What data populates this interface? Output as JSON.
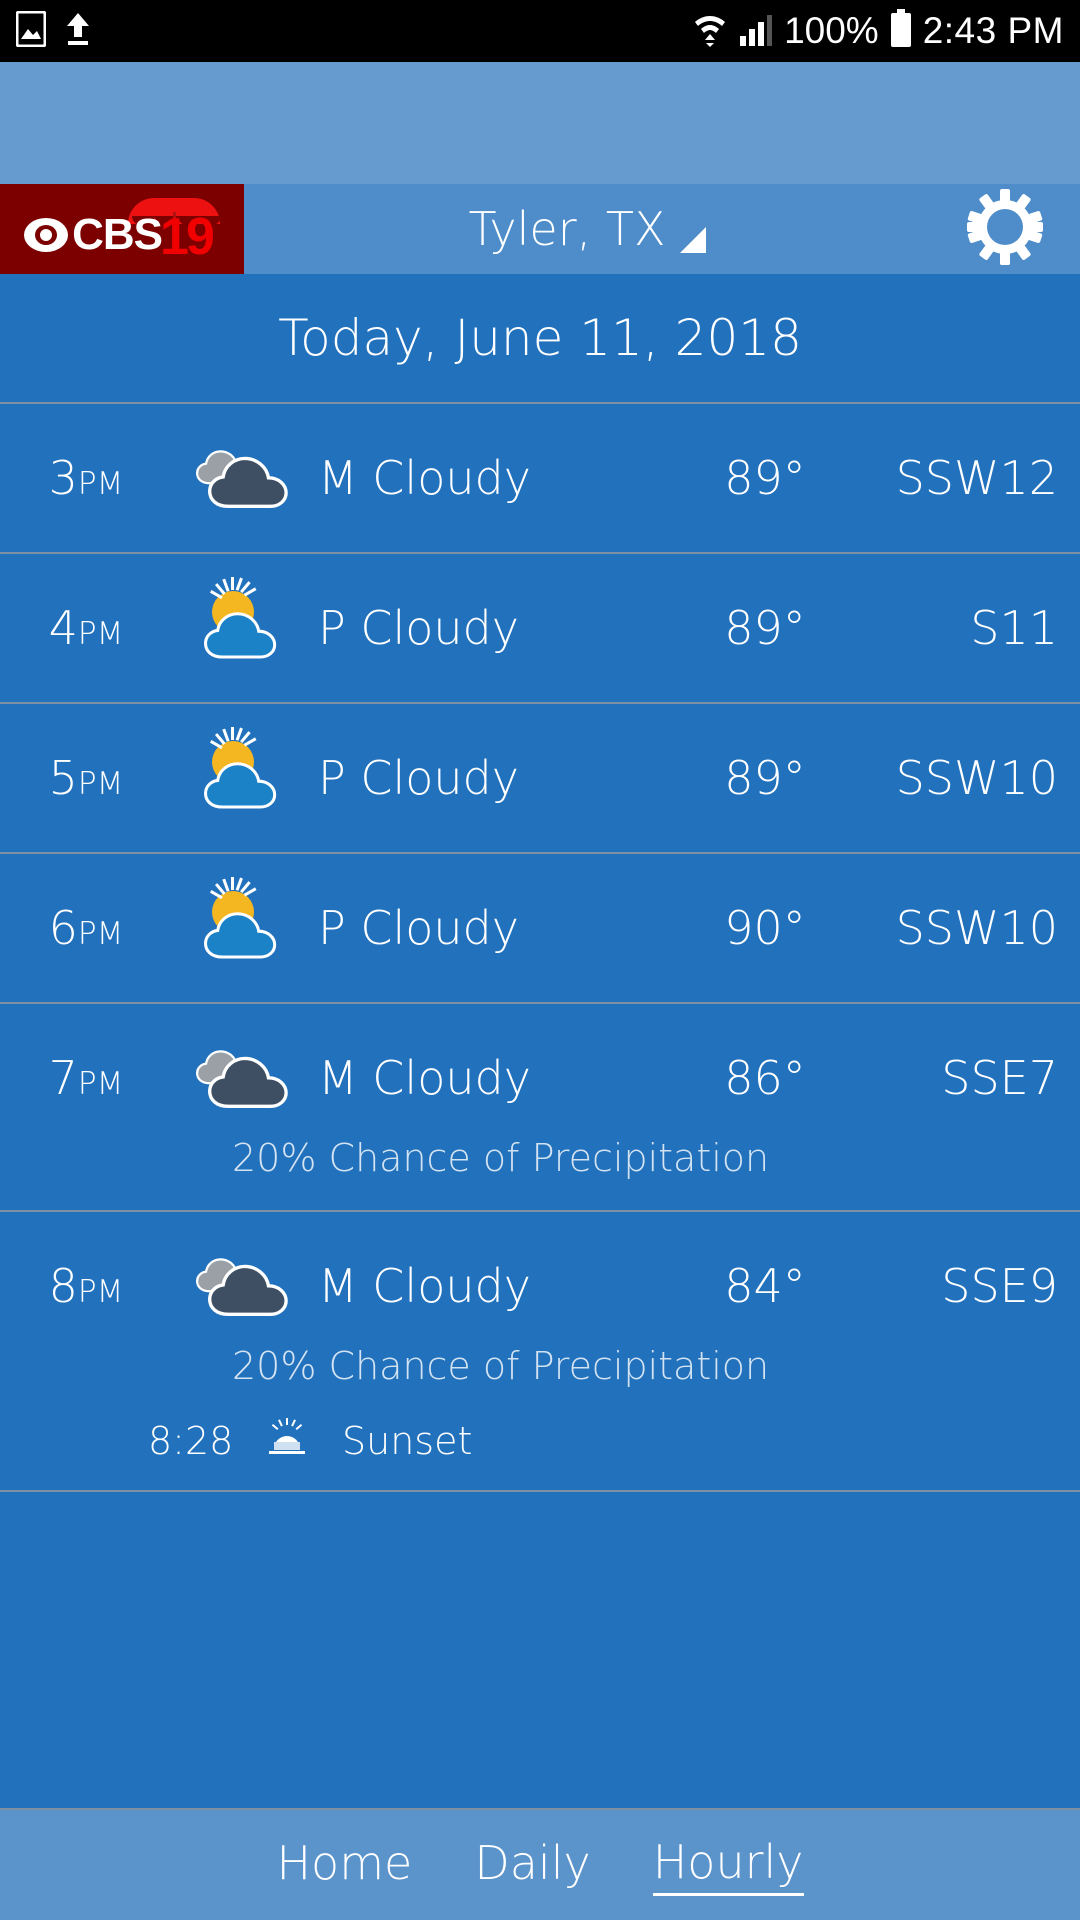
{
  "status_bar": {
    "icons": [
      "image-icon",
      "upload-icon",
      "wifi-icon",
      "signal-icon"
    ],
    "battery_percent": "100%",
    "time": "2:43 PM"
  },
  "header": {
    "logo": {
      "eye": "cbs-eye-icon",
      "network": "CBS",
      "channel": "19",
      "umbrella": "umbrella-icon"
    },
    "location": "Tyler, TX",
    "location_caret": "dropdown-caret-icon",
    "settings_icon": "gear-icon"
  },
  "date_header": {
    "title": "Today, June 11, 2018"
  },
  "hourly": [
    {
      "time_hour": "3",
      "time_ampm": "PM",
      "icon": "mostly-cloudy-icon",
      "condition": "M Cloudy",
      "temp": "89°",
      "wind": "SSW12",
      "precip": null,
      "sun": null
    },
    {
      "time_hour": "4",
      "time_ampm": "PM",
      "icon": "partly-cloudy-icon",
      "condition": "P Cloudy",
      "temp": "89°",
      "wind": "S11",
      "precip": null,
      "sun": null
    },
    {
      "time_hour": "5",
      "time_ampm": "PM",
      "icon": "partly-cloudy-icon",
      "condition": "P Cloudy",
      "temp": "89°",
      "wind": "SSW10",
      "precip": null,
      "sun": null
    },
    {
      "time_hour": "6",
      "time_ampm": "PM",
      "icon": "partly-cloudy-icon",
      "condition": "P Cloudy",
      "temp": "90°",
      "wind": "SSW10",
      "precip": null,
      "sun": null
    },
    {
      "time_hour": "7",
      "time_ampm": "PM",
      "icon": "mostly-cloudy-icon",
      "condition": "M Cloudy",
      "temp": "86°",
      "wind": "SSE7",
      "precip": "20% Chance of Precipitation",
      "sun": null
    },
    {
      "time_hour": "8",
      "time_ampm": "PM",
      "icon": "mostly-cloudy-icon",
      "condition": "M Cloudy",
      "temp": "84°",
      "wind": "SSE9",
      "precip": "20% Chance of Precipitation",
      "sun": {
        "time": "8:28",
        "label": "Sunset",
        "icon": "sunset-icon"
      }
    }
  ],
  "bottom_nav": {
    "items": [
      {
        "label": "Home",
        "active": false
      },
      {
        "label": "Daily",
        "active": false
      },
      {
        "label": "Hourly",
        "active": true
      }
    ]
  },
  "colors": {
    "status_bar_bg": "#000000",
    "top_band": "#659bce",
    "header_bar": "#4e8dc9",
    "content_bg": "#2271bc",
    "logo_bg": "#7c0000",
    "logo_red": "#f00000",
    "divider": "#7e91a4",
    "nav_bg": "#5b93cb",
    "sun_yellow": "#f5b721",
    "cloud_dark": "#3f4f63",
    "cloud_gray": "#9aa0a6",
    "cloud_blue": "#1b82c8",
    "text": "#ffffff",
    "precip_text": "#d3e3f2"
  }
}
